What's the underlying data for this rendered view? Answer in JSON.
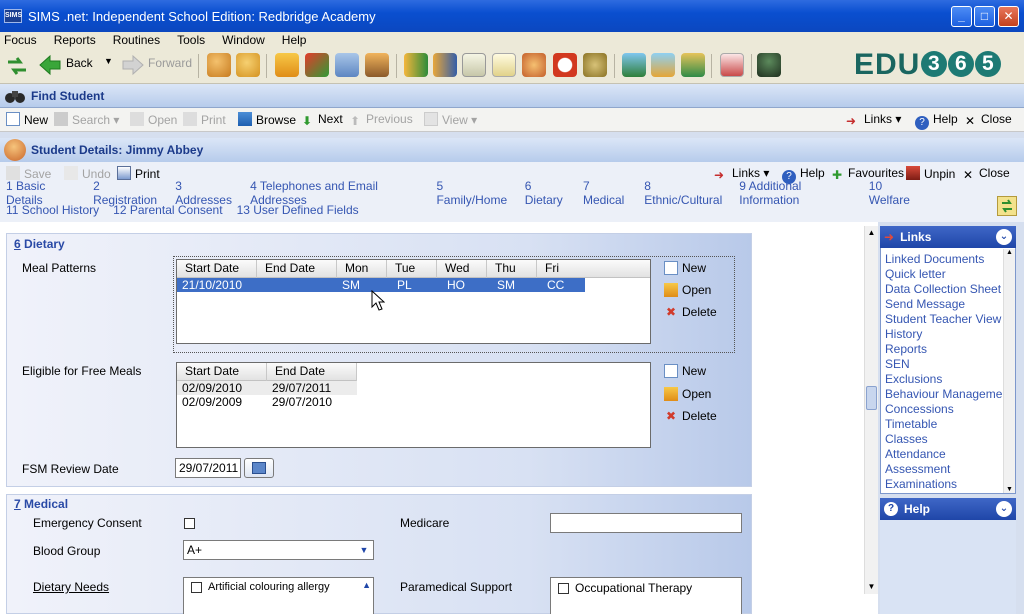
{
  "window": {
    "title": "SIMS .net: Independent School Edition: Redbridge Academy",
    "app_icon": "SIMS"
  },
  "menu": [
    "Focus",
    "Reports",
    "Routines",
    "Tools",
    "Window",
    "Help"
  ],
  "toolbar": {
    "back": "Back",
    "forward": "Forward",
    "brand_prefix": "EDU",
    "brand_digits": [
      "3",
      "6",
      "5"
    ]
  },
  "find": {
    "title": "Find Student",
    "new": "New",
    "search": "Search",
    "open": "Open",
    "print": "Print",
    "browse": "Browse",
    "next": "Next",
    "previous": "Previous",
    "view": "View",
    "links": "Links",
    "help": "Help",
    "close": "Close"
  },
  "student": {
    "title": "Student Details: Jimmy Abbey",
    "save": "Save",
    "undo": "Undo",
    "print": "Print",
    "links": "Links",
    "help": "Help",
    "favourites": "Favourites",
    "unpin": "Unpin",
    "close": "Close"
  },
  "sections_row1": [
    "1 Basic Details",
    "2 Registration",
    "3 Addresses",
    "4 Telephones and Email Addresses",
    "5 Family/Home",
    "6 Dietary",
    "7 Medical",
    "8 Ethnic/Cultural",
    "9 Additional Information",
    "10 Welfare"
  ],
  "sections_row2": [
    "11 School History",
    "12 Parental Consent",
    "13 User Defined Fields"
  ],
  "dietary": {
    "heading_num": "6",
    "heading": " Dietary",
    "meal_label": "Meal Patterns",
    "meal_cols": [
      "Start Date",
      "End Date",
      "Mon",
      "Tue",
      "Wed",
      "Thu",
      "Fri"
    ],
    "meal_rows": [
      [
        "21/10/2010",
        "",
        "SM",
        "PL",
        "HO",
        "SM",
        "CC"
      ]
    ],
    "free_label": "Eligible for Free Meals",
    "free_cols": [
      "Start Date",
      "End Date"
    ],
    "free_rows": [
      [
        "02/09/2010",
        "29/07/2011"
      ],
      [
        "02/09/2009",
        "29/07/2010"
      ]
    ],
    "new": "New",
    "open": "Open",
    "delete": "Delete",
    "fsm_label": "FSM Review Date",
    "fsm_value": "29/07/2011"
  },
  "medical": {
    "heading_num": "7",
    "heading": " Medical",
    "emergency": "Emergency Consent",
    "medicare": "Medicare",
    "blood_label": "Blood Group",
    "blood_value": "A+",
    "dietary_needs": "Dietary Needs",
    "dietary_item": "Artificial colouring allergy",
    "paramedical": "Paramedical Support",
    "paramedical_item": "Occupational Therapy"
  },
  "links_panel": {
    "title": "Links",
    "items": [
      "Linked Documents",
      "Quick letter",
      "Data Collection Sheet",
      "Send Message",
      "Student Teacher View",
      "History",
      "Reports",
      "SEN",
      "Exclusions",
      "Behaviour Management",
      "Concessions",
      "Timetable",
      "Classes",
      "Attendance",
      "Assessment",
      "Examinations"
    ]
  },
  "help_panel": {
    "title": "Help"
  },
  "colors": {
    "accent": "#3d6ec6",
    "title_bar": "#0a4fd0",
    "link": "#3556b2"
  }
}
